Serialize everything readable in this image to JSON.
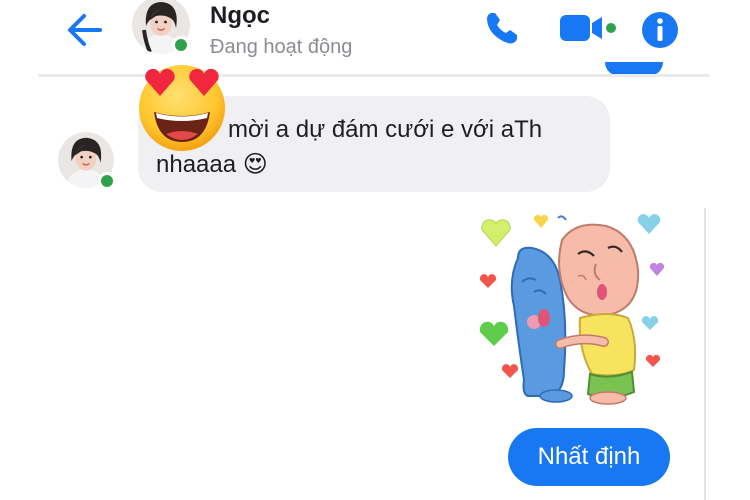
{
  "header": {
    "contact_name": "Ngọc",
    "status_text": "Đang hoạt động",
    "icons": {
      "back": "back-arrow-icon",
      "call": "phone-icon",
      "video": "video-camera-icon",
      "info": "info-icon"
    }
  },
  "messages": [
    {
      "sender": "Ngọc",
      "direction": "incoming",
      "text": "mời a dự đám cưới e với aTh nhaaaa",
      "emoji": "😍",
      "reaction_sticker": "heart-eyes-emoji"
    },
    {
      "direction": "outgoing",
      "type": "sticker",
      "sticker_name": "hugging-characters-sticker"
    },
    {
      "direction": "outgoing",
      "text": "Nhất định"
    }
  ],
  "colors": {
    "accent": "#1877f2",
    "incoming_bubble": "#f0f0f3",
    "online": "#31a24c",
    "status_text": "#8a8d91"
  }
}
